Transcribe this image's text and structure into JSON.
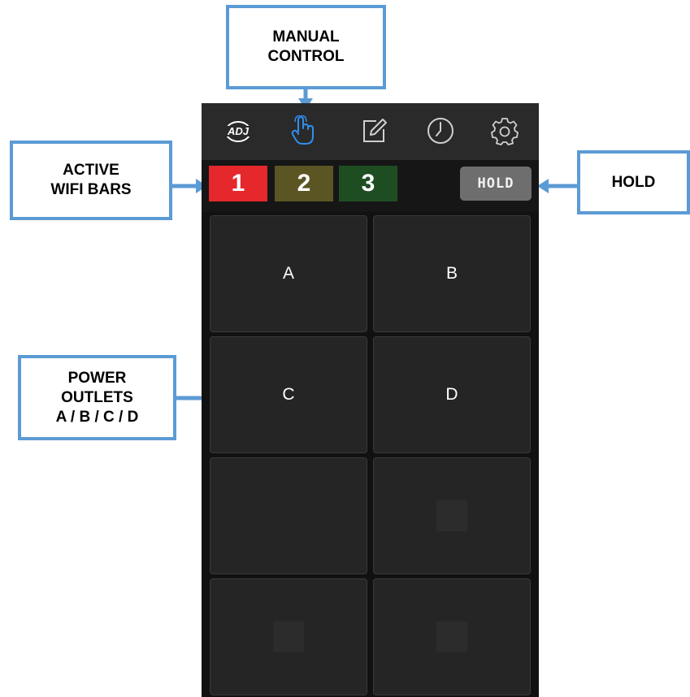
{
  "callouts": {
    "manual_control": "MANUAL\nCONTROL",
    "active_wifi_bars": "ACTIVE\nWIFI BARS",
    "hold": "HOLD",
    "power_outlets": "POWER\nOUTLETS\nA / B / C / D"
  },
  "toolbar": {
    "icons": [
      "adj-logo-icon",
      "touch-hand-icon",
      "edit-icon",
      "clock-icon",
      "gear-icon"
    ],
    "logo_text": "ADJ"
  },
  "status": {
    "wifi_bars": [
      "1",
      "2",
      "3"
    ],
    "hold_label": "HOLD"
  },
  "outlets": [
    "A",
    "B",
    "C",
    "D",
    "",
    "",
    "",
    ""
  ],
  "colors": {
    "callout_border": "#5b9bd5",
    "active_icon": "#2e8ff0",
    "wifi_1": "#e5282b",
    "wifi_2": "#5b5524",
    "wifi_3": "#1f4d22",
    "hold_button": "#6e6e6e",
    "pad": "#252525"
  }
}
